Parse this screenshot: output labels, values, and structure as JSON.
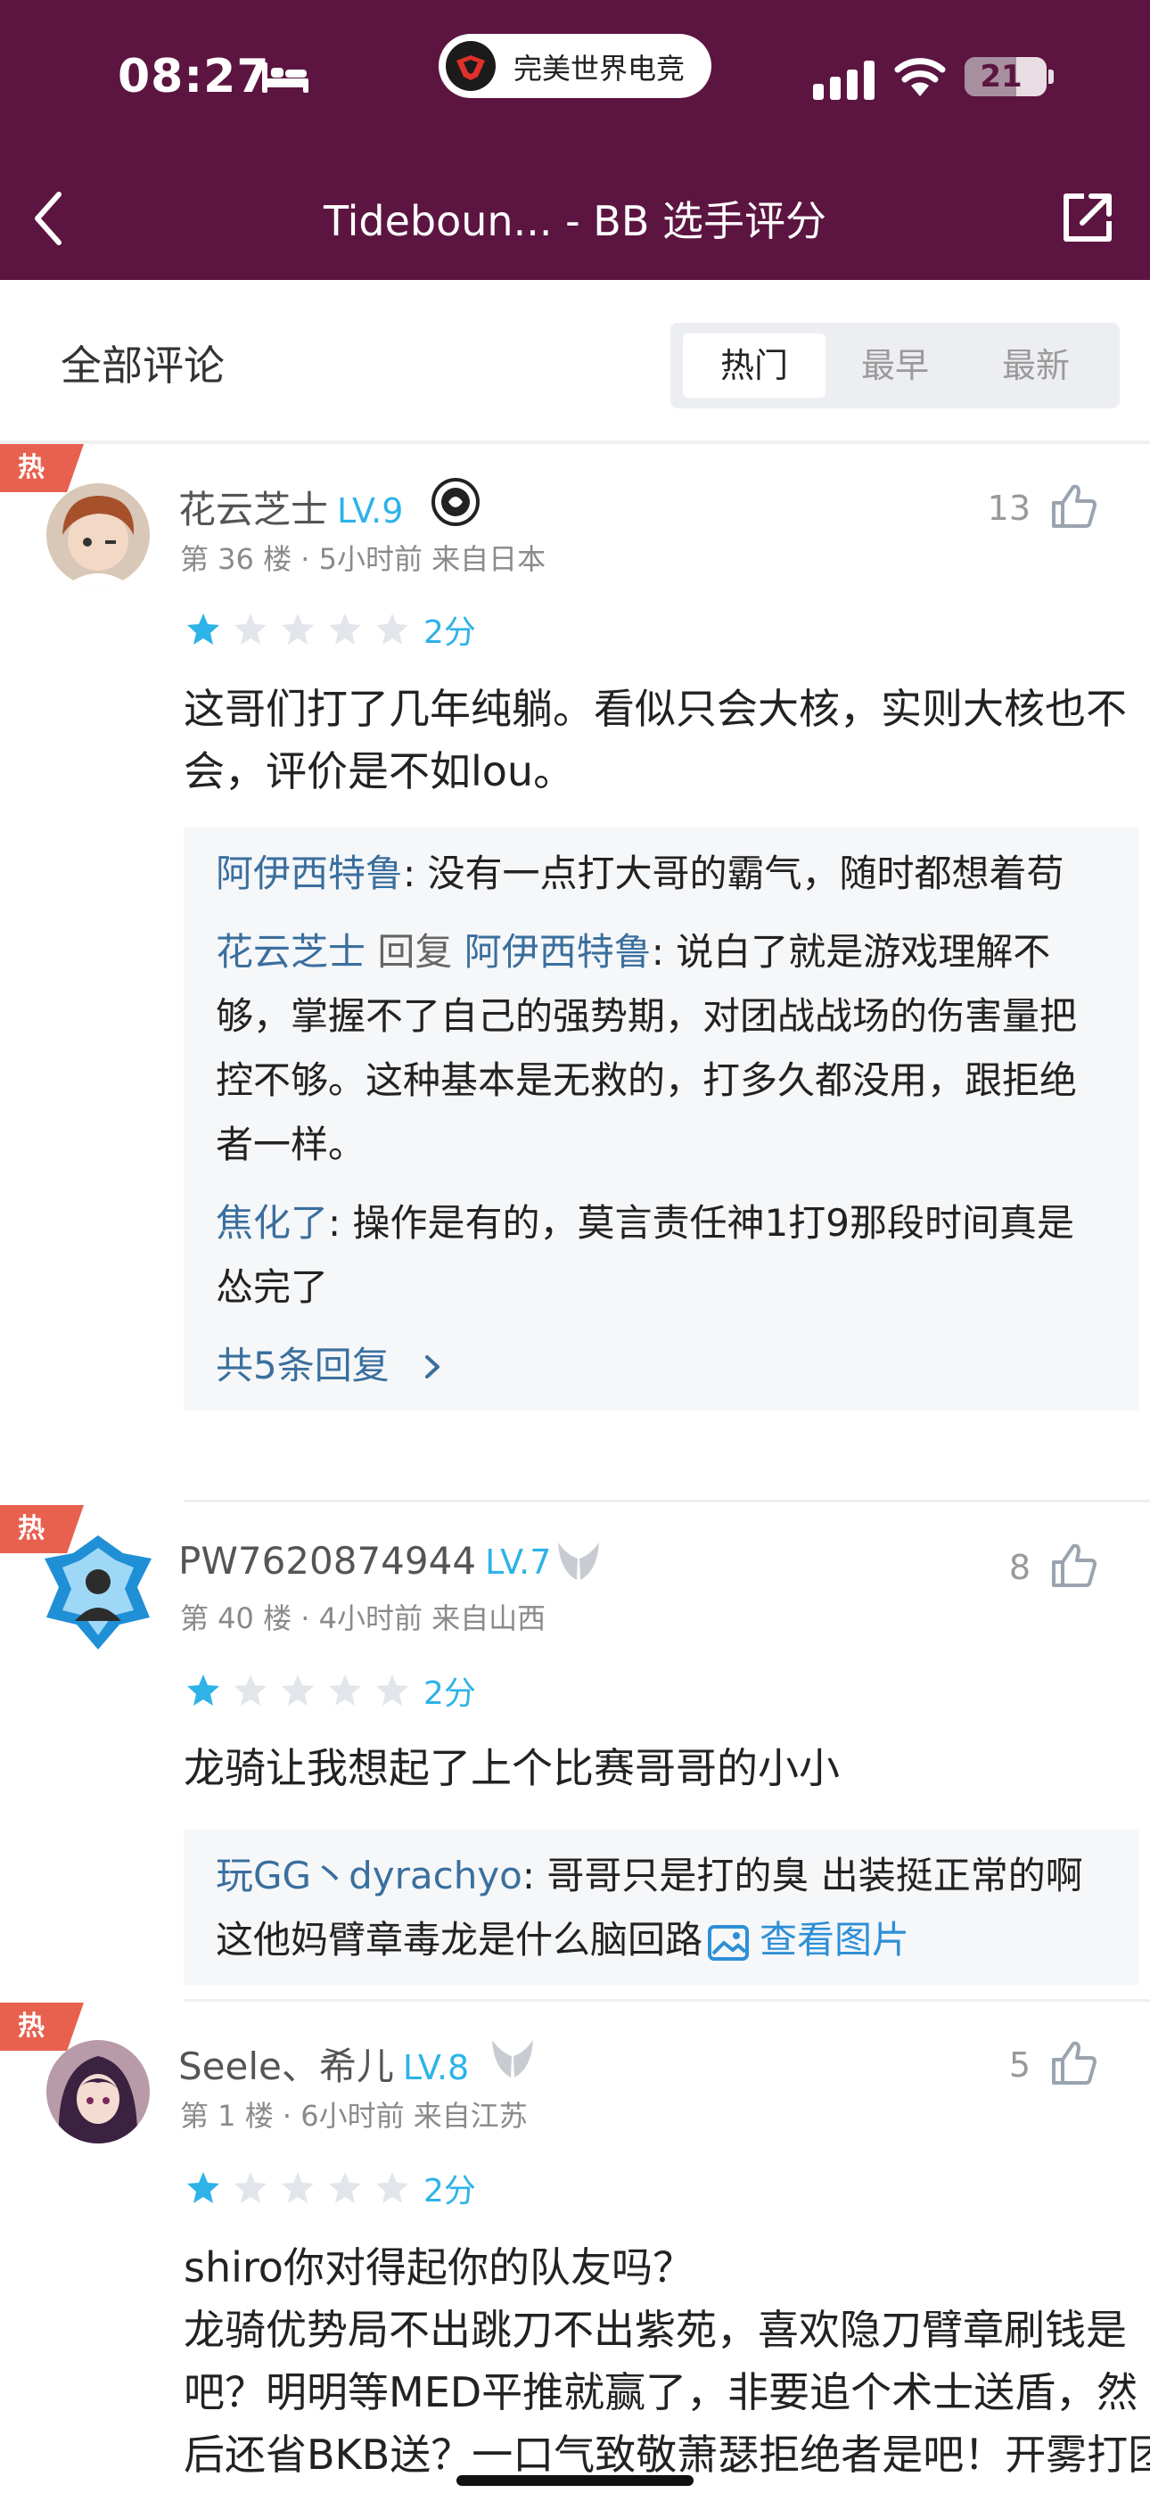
{
  "status_bar": {
    "time": "08:27",
    "app_pill_label": "完美世界电竞",
    "battery": "21"
  },
  "header": {
    "title": "Tideboun... - BB 选手评分"
  },
  "section": {
    "title": "全部评论",
    "sort_tabs": [
      {
        "label": "热门",
        "active": true
      },
      {
        "label": "最早",
        "active": false
      },
      {
        "label": "最新",
        "active": false
      }
    ]
  },
  "comments": [
    {
      "hot_label": "热",
      "username": "花云芝士",
      "level": "LV.9",
      "meta": "第 36 楼 · 5小时前  来自日本",
      "likes": "13",
      "rating": 1,
      "rating_max": 5,
      "score": "2分",
      "body": "这哥们打了几年纯躺。看似只会大核，实则大核也不会，评价是不如lou。",
      "replies": [
        {
          "author": "阿伊西特鲁",
          "reply_word": "",
          "reply_to": "",
          "text": ": 没有一点打大哥的霸气，随时都想着苟"
        },
        {
          "author": "花云芝士",
          "reply_word": " 回复 ",
          "reply_to": "阿伊西特鲁",
          "text": ": 说白了就是游戏理解不够，掌握不了自己的强势期，对团战战场的伤害量把控不够。这种基本是无救的，打多久都没用，跟拒绝者一样。"
        },
        {
          "author": "焦化了",
          "reply_word": "",
          "reply_to": "",
          "text": ": 操作是有的，莫言责任神1打9那段时间真是怂完了"
        }
      ],
      "more_replies": "共5条回复"
    },
    {
      "hot_label": "热",
      "username": "PW7620874944",
      "level": "LV.7",
      "meta": "第 40 楼 · 4小时前  来自山西",
      "likes": "8",
      "rating": 1,
      "rating_max": 5,
      "score": "2分",
      "body": "龙骑让我想起了上个比赛哥哥的小小",
      "replies": [
        {
          "author": "玩GG丶dyrachyo",
          "text": ": 哥哥只是打的臭 出装挺正常的啊 这他妈臂章毒龙是什么脑回路",
          "view_image": "查看图片"
        }
      ]
    },
    {
      "hot_label": "热",
      "username": "Seele、希儿",
      "level": "LV.8",
      "meta": "第 1 楼 · 6小时前  来自江苏",
      "likes": "5",
      "rating": 1,
      "rating_max": 5,
      "score": "2分",
      "body_lines": [
        "shiro你对得起你的队友吗？",
        "龙骑优势局不出跳刀不出紫苑，喜欢隐刀臂章刷钱是吧？明明等MED平推就赢了，非要追个术士送盾，然后还省BKB送？一口气致敬萧瑟拒绝者是吧！开雾打团沈箭一个死，你以为你有鼻子"
      ]
    }
  ],
  "colors": {
    "header_bg": "#5c1540",
    "accent": "#2db3e8",
    "hot": "#e8614f",
    "reply_name": "#3a6f9e"
  }
}
